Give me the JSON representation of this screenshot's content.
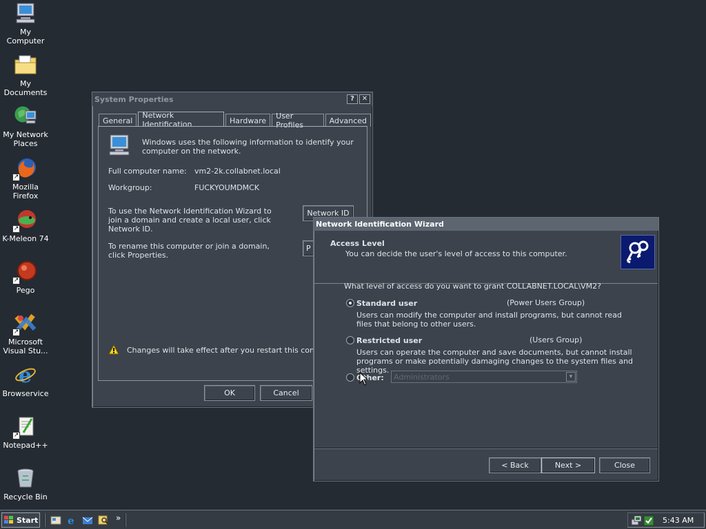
{
  "desktop": {
    "icons": [
      {
        "label": "My Computer"
      },
      {
        "label": "My Documents"
      },
      {
        "label": "My Network Places"
      },
      {
        "label": "Mozilla Firefox"
      },
      {
        "label": "K-Meleon 74"
      },
      {
        "label": "Pego"
      },
      {
        "label": "Microsoft Visual Stu..."
      },
      {
        "label": "Browservice"
      },
      {
        "label": "Notepad++"
      },
      {
        "label": "Recycle Bin"
      }
    ]
  },
  "system_properties": {
    "title": "System Properties",
    "help_btn": "?",
    "close_btn": "✕",
    "tabs": [
      "General",
      "Network Identification",
      "Hardware",
      "User Profiles",
      "Advanced"
    ],
    "active_tab": "Network Identification",
    "intro": "Windows uses the following information to identify your computer on the network.",
    "full_name_label": "Full computer name:",
    "full_name_value": "vm2-2k.collabnet.local",
    "workgroup_label": "Workgroup:",
    "workgroup_value": "FUCKYOUMDMCK",
    "wizard_text": "To use the Network Identification Wizard to join a domain and create a local user, click Network ID.",
    "network_id_btn": "Network ID",
    "rename_text": "To rename this computer or join a domain, click Properties.",
    "properties_btn": "P",
    "restart_warning": "Changes will take effect after you restart this computer.",
    "ok_btn": "OK",
    "cancel_btn": "Cancel"
  },
  "wizard": {
    "title": "Network Identification Wizard",
    "header_title": "Access Level",
    "header_subtitle": "You can decide the user's level of access to this computer.",
    "question": "What level of access do you want to grant COLLABNET.LOCAL\\VM2?",
    "options": [
      {
        "label": "Standard user",
        "group": "(Power Users Group)",
        "desc": "Users can modify the computer and install programs, but cannot read files that belong to other users.",
        "selected": true
      },
      {
        "label": "Restricted user",
        "group": "(Users Group)",
        "desc": "Users can operate the computer and save documents, but cannot install programs or make potentially damaging changes to the system files and settings.",
        "selected": false
      },
      {
        "label": "Other:",
        "group": "",
        "desc": "",
        "selected": false
      }
    ],
    "other_combo_value": "Administrators",
    "back_btn": "< Back",
    "next_btn": "Next >",
    "close_btn": "Close"
  },
  "taskbar": {
    "start_label": "Start",
    "overflow_chevron": "»",
    "clock": "5:43 AM"
  },
  "colors": {
    "desktop_bg": "#252b33",
    "window_bg": "#3c434c",
    "wizard_title_bg": "#5d6670",
    "header_icon_bg": "#0a1a6e"
  }
}
